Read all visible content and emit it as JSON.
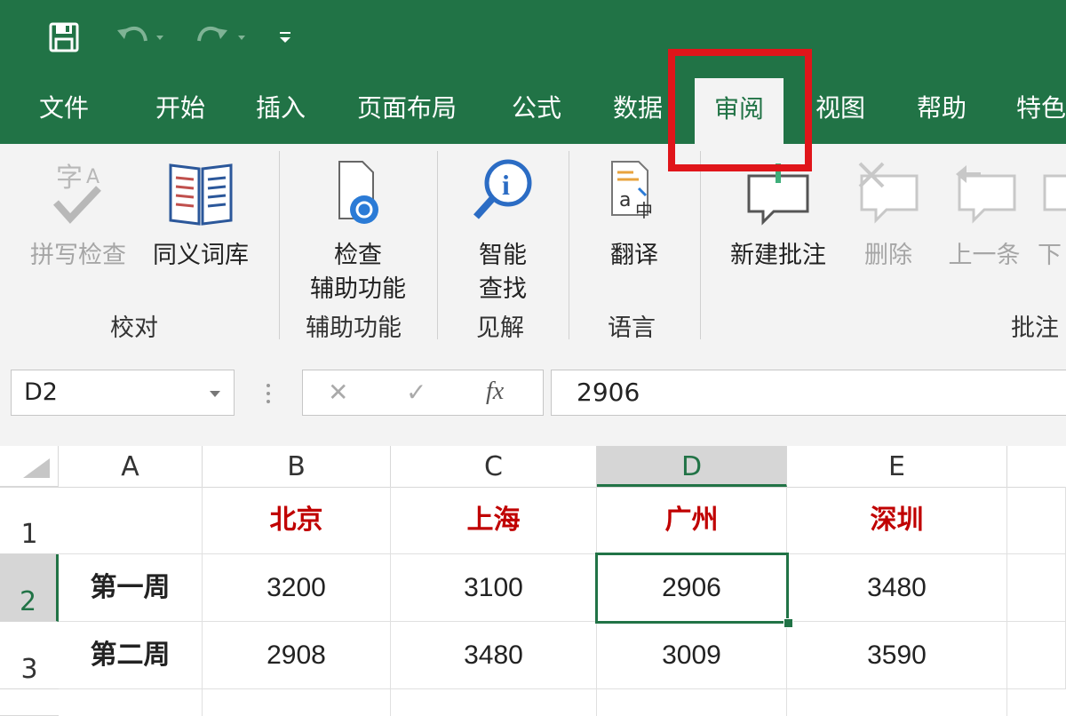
{
  "app": {
    "accent": "#217346",
    "highlight_color": "#e0151a"
  },
  "tabs": [
    {
      "label": "文件"
    },
    {
      "label": "开始"
    },
    {
      "label": "插入"
    },
    {
      "label": "页面布局"
    },
    {
      "label": "公式"
    },
    {
      "label": "数据"
    },
    {
      "label": "审阅",
      "active": true
    },
    {
      "label": "视图"
    },
    {
      "label": "帮助"
    },
    {
      "label": "特色"
    }
  ],
  "ribbon": {
    "spell_check": "拼写检查",
    "thesaurus": "同义词库",
    "group_proofing": "校对",
    "check_accessibility_1": "检查",
    "check_accessibility_2": "辅助功能",
    "group_accessibility": "辅助功能",
    "smart_lookup_1": "智能",
    "smart_lookup_2": "查找",
    "group_insights": "见解",
    "translate": "翻译",
    "group_language": "语言",
    "new_comment": "新建批注",
    "delete": "删除",
    "previous": "上一条",
    "next": "下",
    "group_comments": "批注"
  },
  "formula_bar": {
    "name_box": "D2",
    "fx": "fx",
    "formula": "2906"
  },
  "sheet": {
    "columns": [
      "A",
      "B",
      "C",
      "D",
      "E"
    ],
    "rows": [
      {
        "num": "1",
        "cells": [
          "",
          "北京",
          "上海",
          "广州",
          "深圳"
        ]
      },
      {
        "num": "2",
        "cells": [
          "第一周",
          "3200",
          "3100",
          "2906",
          "3480"
        ]
      },
      {
        "num": "3",
        "cells": [
          "第二周",
          "2908",
          "3480",
          "3009",
          "3590"
        ]
      }
    ],
    "selected_cell": "D2"
  }
}
